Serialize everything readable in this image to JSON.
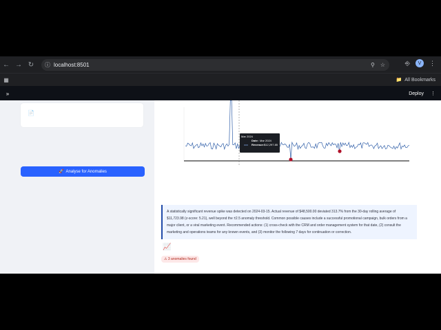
{
  "browser": {
    "url": "localhost:8501",
    "bookmarks_label": "All Bookmarks",
    "profile_initial": "V"
  },
  "app": {
    "deploy_label": "Deploy",
    "analyze_label": "Analyse for Anomalies"
  },
  "tooltip": {
    "header": "Mar 2024",
    "date_label": "Date:",
    "date_value": "Mar 2024",
    "revenue_label": "Revenue:",
    "revenue_value": "$12,297.85"
  },
  "explanation": "A statistically significant revenue spike was detected on 2024-03-15. Actual revenue of $48,500.00 deviated 313.7% from the 30-day rolling average of $11,723.98 (z-score: 5.21), well beyond the ±2.5 anomaly threshold. Common possible causes include a successful promotional campaign, bulk orders from a major client, or a viral marketing event. Recommended actions: (1) cross-check with the CRM and order management system for that date, (2) consult the marketing and operations teams for any known events, and (3) monitor the following 7 days for continuation or correction.",
  "anomaly_badge": "3 anomalies found",
  "colors": {
    "accent": "#2962ff",
    "line": "#2f5ea8",
    "anomaly": "#b0122a"
  }
}
